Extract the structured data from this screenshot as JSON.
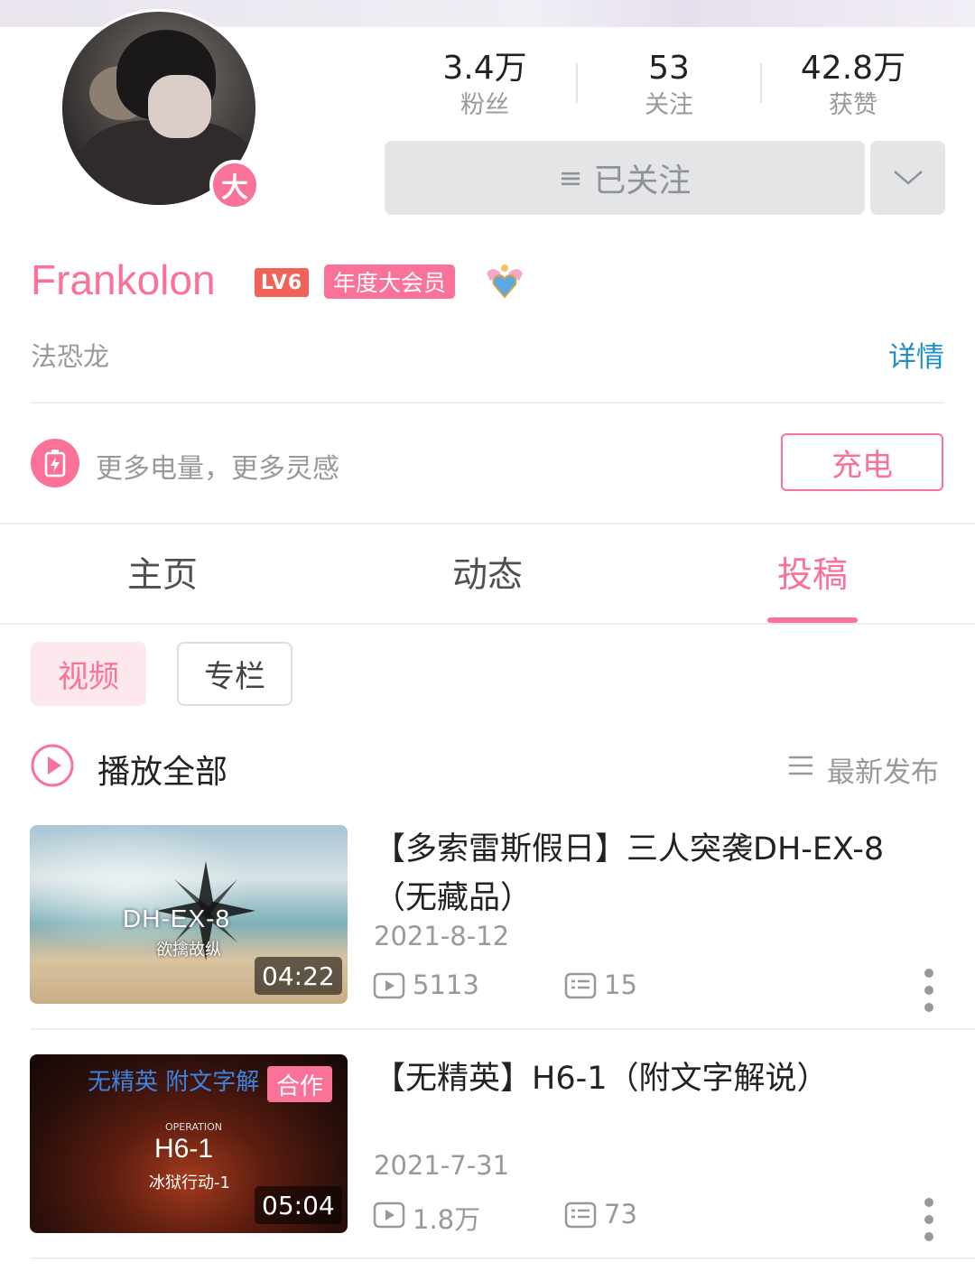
{
  "profile": {
    "vip_badge": "大",
    "name": "Frankolon",
    "level": "LV6",
    "vip_tag": "年度大会员",
    "pendant_icon": "angel-heart-pendant",
    "signature": "法恐龙",
    "details_link": "详情"
  },
  "stats": [
    {
      "value": "3.4万",
      "label": "粉丝"
    },
    {
      "value": "53",
      "label": "关注"
    },
    {
      "value": "42.8万",
      "label": "获赞"
    }
  ],
  "follow": {
    "label": "已关注",
    "menu_icon": "hamburger-icon",
    "dropdown_icon": "chevron-down-icon"
  },
  "charge": {
    "text": "更多电量，更多灵感",
    "button": "充电"
  },
  "tabs": [
    {
      "label": "主页",
      "active": false
    },
    {
      "label": "动态",
      "active": false
    },
    {
      "label": "投稿",
      "active": true
    }
  ],
  "subtabs": {
    "video": "视频",
    "column": "专栏"
  },
  "list_header": {
    "play_all": "播放全部",
    "sort": "最新发布"
  },
  "videos": [
    {
      "title": "【多索雷斯假日】三人突袭DH-EX-8（无藏品）",
      "date": "2021-8-12",
      "duration": "04:22",
      "plays": "5113",
      "comments": "15",
      "thumb_code": "DH-EX-8",
      "thumb_sub": "欲擒故纵",
      "collab": ""
    },
    {
      "title": "【无精英】H6-1（附文字解说）",
      "date": "2021-7-31",
      "duration": "05:04",
      "plays": "1.8万",
      "comments": "73",
      "thumb_title": "无精英  附文字解",
      "thumb_op": "OPERATION",
      "thumb_code": "H6-1",
      "thumb_sub": "冰狱行动-1",
      "collab": "合作"
    }
  ],
  "colors": {
    "accent": "#fb7299",
    "link": "#1d8fc2",
    "level": "#f0625a"
  }
}
